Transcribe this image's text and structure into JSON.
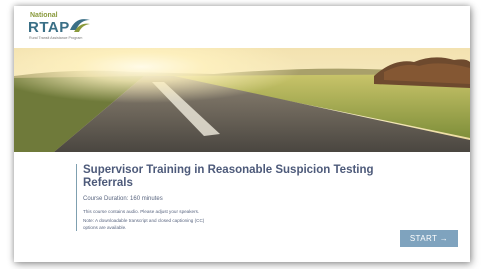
{
  "header": {
    "logo": {
      "line1": "National",
      "line2": "RTAP",
      "tagline": "Rural Transit Assistance Program"
    }
  },
  "course": {
    "title": "Supervisor Training in Reasonable Suspicion Testing Referrals",
    "duration": "Course Duration: 160 minutes",
    "audio_note": "This course contains audio. Please adjust your speakers.",
    "transcript_note": "Note: A downloadable transcript and closed captioning (CC) options are available."
  },
  "actions": {
    "start_label": "START →"
  },
  "colors": {
    "accent": "#7fa3be",
    "title_text": "#4d5a7a",
    "logo_blue": "#3a6f86",
    "logo_green": "#8a9a3c"
  },
  "icons": {
    "logo_mark": "swoosh-logo-icon",
    "start_arrow": "arrow-right-icon"
  }
}
